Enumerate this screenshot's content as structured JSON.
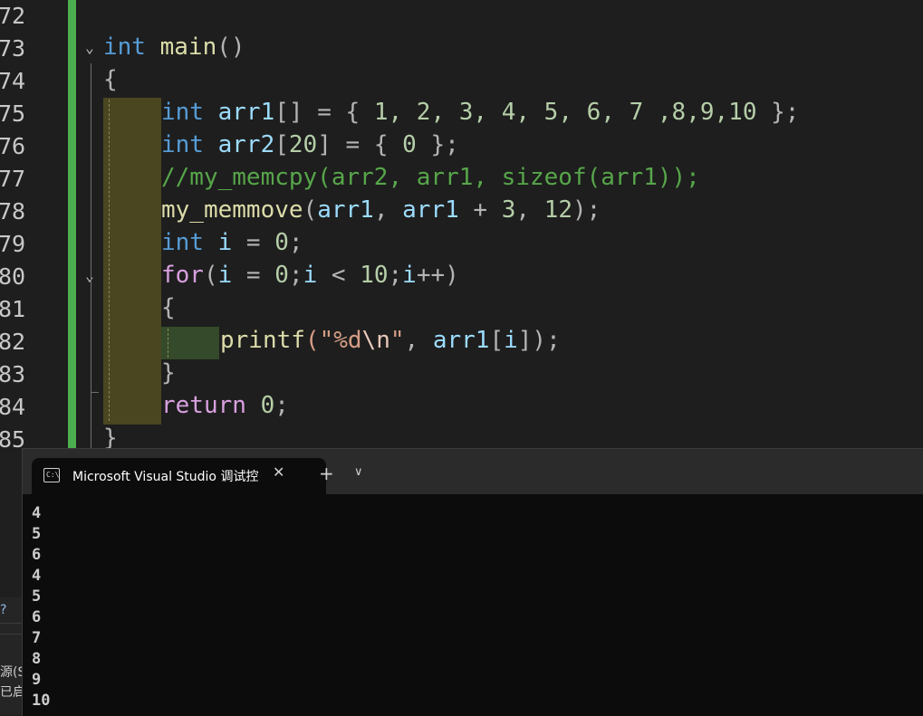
{
  "editor": {
    "line_numbers": [
      "72",
      "73",
      "74",
      "75",
      "76",
      "77",
      "78",
      "79",
      "80",
      "81",
      "82",
      "83",
      "84",
      "85"
    ],
    "code": {
      "l73": {
        "kw": "int",
        "fn": "main",
        "rest": "()"
      },
      "l74": "{",
      "l75": {
        "kw": "int",
        "var": "arr1",
        "a": "[] = { ",
        "nums": "1, 2, 3, 4, 5, 6, 7 ,8,9,10",
        "b": " };"
      },
      "l76": {
        "kw": "int",
        "var": "arr2",
        "a": "[",
        "n": "20",
        "b": "] = { ",
        "n2": "0",
        "c": " };"
      },
      "l77": "//my_memcpy(arr2, arr1, sizeof(arr1));",
      "l78": {
        "fn": "my_memmove",
        "a": "(",
        "v1": "arr1",
        ",": ", ",
        "v2": "arr1",
        "b": " + ",
        "n": "3",
        ",2": ", ",
        "n2": "12",
        "c": ");"
      },
      "l79": {
        "kw": "int",
        "var": "i",
        "a": " = ",
        "n": "0",
        "b": ";"
      },
      "l80": {
        "kw": "for",
        "a": "(",
        "v1": "i",
        "b": " = ",
        "n1": "0",
        "c": ";",
        "v2": "i",
        "d": " < ",
        "n2": "10",
        "e": ";",
        "v3": "i",
        "f": "++)"
      },
      "l81": "{",
      "l82": {
        "fn": "printf",
        "a": "(\"",
        "s1": "%d",
        "esc": "\\n",
        "s2": "\"",
        ",": ", ",
        "var": "arr1",
        "b": "[",
        "v2": "i",
        "c": "]);"
      },
      "l83": "}",
      "l84": {
        "kw": "return",
        "a": " ",
        "n": "0",
        "b": ";"
      },
      "l85": "}"
    }
  },
  "left_stub": {
    "t1": "?",
    "t2": "源(S",
    "t3": "已启"
  },
  "terminal": {
    "tab_title": "Microsoft Visual Studio 调试控",
    "close_glyph": "✕",
    "new_tab_glyph": "+",
    "dropdown_glyph": "∨",
    "output": [
      "4",
      "5",
      "6",
      "4",
      "5",
      "6",
      "7",
      "8",
      "9",
      "10"
    ]
  },
  "colors": {
    "keyword": "#569cd6",
    "control": "#d8a0df",
    "function": "#dcdcaa",
    "variable": "#9cdcfe",
    "number": "#b5cea8",
    "string": "#d69d85",
    "comment": "#57a64a",
    "changebar": "#4cae4f"
  }
}
